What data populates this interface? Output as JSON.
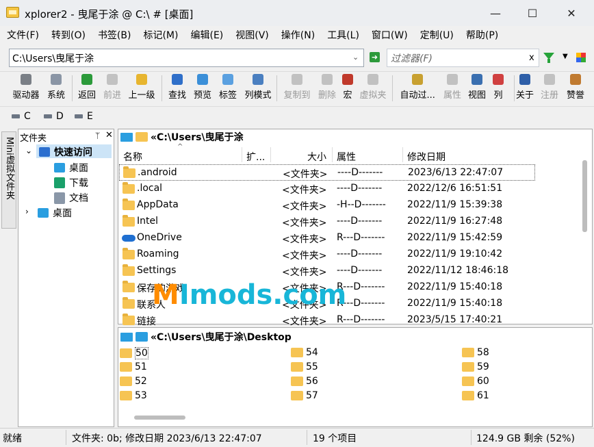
{
  "window": {
    "title": "xplorer2 - 曳尾于涂 @ C:\\ # [桌面]",
    "minimize": "—",
    "maximize": "☐",
    "close": "✕"
  },
  "menu": [
    "文件(F)",
    "转到(O)",
    "书签(B)",
    "标记(M)",
    "编辑(E)",
    "视图(V)",
    "操作(N)",
    "工具(L)",
    "窗口(W)",
    "定制(U)",
    "帮助(P)"
  ],
  "address": {
    "value": "C:\\Users\\曳尾于涂",
    "filter_placeholder": "过滤器(F)",
    "filter_clear": "x"
  },
  "toolbar": [
    {
      "label": "驱动器",
      "icon": "drive-icon",
      "color": "#7a7f86",
      "enabled": true
    },
    {
      "label": "系统",
      "icon": "system-icon",
      "color": "#8a95a5",
      "enabled": true
    },
    {
      "label": "返回",
      "icon": "back-arrow-icon",
      "color": "#2b9a3a",
      "enabled": true
    },
    {
      "label": "前进",
      "icon": "forward-arrow-icon",
      "color": "#8a8a8a",
      "enabled": false
    },
    {
      "label": "上一级",
      "icon": "up-folder-icon",
      "color": "#e7b52f",
      "enabled": true
    },
    {
      "label": "查找",
      "icon": "find-icon",
      "color": "#2f6fc9",
      "enabled": true
    },
    {
      "label": "预览",
      "icon": "preview-icon",
      "color": "#3b8fd8",
      "enabled": true
    },
    {
      "label": "标签",
      "icon": "tab-icon",
      "color": "#5aa0e0",
      "enabled": true
    },
    {
      "label": "列模式",
      "icon": "column-mode-icon",
      "color": "#4a7fc0",
      "enabled": true
    },
    {
      "label": "复制到",
      "icon": "copy-to-icon",
      "color": "#888888",
      "enabled": false
    },
    {
      "label": "删除",
      "icon": "delete-icon",
      "color": "#888888",
      "enabled": false
    },
    {
      "label": "宏",
      "icon": "macro-icon",
      "color": "#c0392b",
      "enabled": true
    },
    {
      "label": "虚拟夹",
      "icon": "virtual-folder-icon",
      "color": "#888888",
      "enabled": false
    },
    {
      "label": "自动过...",
      "icon": "auto-filter-icon",
      "color": "#c8a030",
      "enabled": true
    },
    {
      "label": "属性",
      "icon": "properties-icon",
      "color": "#888888",
      "enabled": false
    },
    {
      "label": "视图",
      "icon": "view-icon",
      "color": "#3a6fb0",
      "enabled": true
    },
    {
      "label": "列",
      "icon": "columns-icon",
      "color": "#d04040",
      "enabled": true
    },
    {
      "label": "关于",
      "icon": "help-icon",
      "color": "#2e5fa8",
      "enabled": true
    },
    {
      "label": "注册",
      "icon": "register-icon",
      "color": "#888888",
      "enabled": false
    },
    {
      "label": "赞誉",
      "icon": "praise-icon",
      "color": "#c07a30",
      "enabled": true
    }
  ],
  "drives": [
    "C",
    "D",
    "E"
  ],
  "left_tab": "Mini虚拟文件夹",
  "tree": {
    "title": "文件夹",
    "pin": "ᛘ",
    "close": "✕",
    "items": [
      {
        "label": "快速访问",
        "icon": "star-icon",
        "color": "#2b6fcf"
      },
      {
        "label": "桌面",
        "icon": "desktop-icon",
        "color": "#2a9ee0"
      },
      {
        "label": "下载",
        "icon": "download-icon",
        "color": "#1aa06a"
      },
      {
        "label": "文档",
        "icon": "document-icon",
        "color": "#8a97a8"
      },
      {
        "label": "桌面",
        "icon": "desktop-icon",
        "color": "#2a9ee0"
      }
    ]
  },
  "file_pane": {
    "path": "«C:\\Users\\曳尾于涂",
    "columns": [
      "名称",
      "扩...",
      "大小",
      "属性",
      "修改日期"
    ],
    "rows": [
      {
        "name": ".android",
        "size": "<文件夹>",
        "attr": "----D-------",
        "date": "2023/6/13 22:47:07",
        "icon": "folder-icon"
      },
      {
        "name": ".local",
        "size": "<文件夹>",
        "attr": "----D-------",
        "date": "2022/12/6 16:51:51",
        "icon": "folder-icon"
      },
      {
        "name": "AppData",
        "size": "<文件夹>",
        "attr": "-H--D-------",
        "date": "2022/11/9 15:39:38",
        "icon": "folder-icon"
      },
      {
        "name": "Intel",
        "size": "<文件夹>",
        "attr": "----D-------",
        "date": "2022/11/9 16:27:48",
        "icon": "folder-icon"
      },
      {
        "name": "OneDrive",
        "size": "<文件夹>",
        "attr": "R---D-------",
        "date": "2022/11/9 15:42:59",
        "icon": "onedrive-icon"
      },
      {
        "name": "Roaming",
        "size": "<文件夹>",
        "attr": "----D-------",
        "date": "2022/11/9 19:10:42",
        "icon": "folder-icon"
      },
      {
        "name": "Settings",
        "size": "<文件夹>",
        "attr": "----D-------",
        "date": "2022/11/12 18:46:18",
        "icon": "folder-icon"
      },
      {
        "name": "保存的游戏",
        "size": "<文件夹>",
        "attr": "R---D-------",
        "date": "2022/11/9 15:40:18",
        "icon": "folder-icon"
      },
      {
        "name": "联系人",
        "size": "<文件夹>",
        "attr": "R---D-------",
        "date": "2022/11/9 15:40:18",
        "icon": "folder-icon"
      },
      {
        "name": "链接",
        "size": "<文件夹>",
        "attr": "R---D-------",
        "date": "2023/5/15 17:40:21",
        "icon": "folder-icon"
      }
    ]
  },
  "lower_pane": {
    "path": "«C:\\Users\\曳尾于涂\\Desktop",
    "items": [
      "50",
      "51",
      "52",
      "53",
      "54",
      "55",
      "56",
      "57",
      "58",
      "59",
      "60",
      "61"
    ]
  },
  "status": {
    "state": "就绪",
    "info": "文件夹: 0b; 修改日期 2023/6/13 22:47:07",
    "count": "19 个项目",
    "free": "124.9 GB 剩余 (52%)"
  },
  "watermark": {
    "m": "M",
    "rest": "Imods.com"
  }
}
